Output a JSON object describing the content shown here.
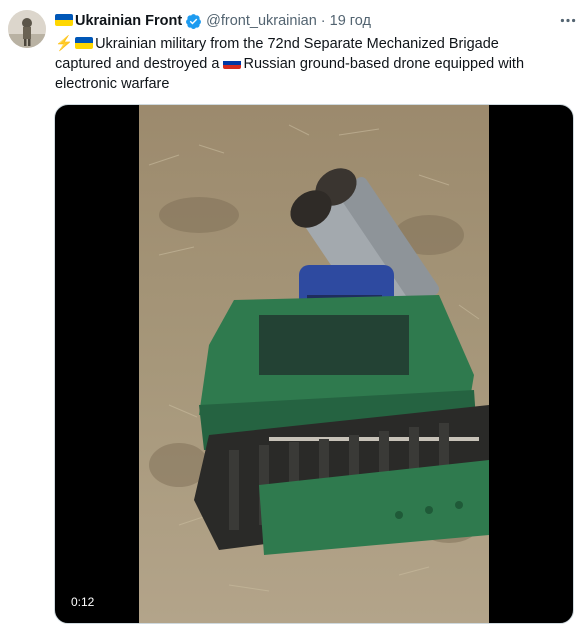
{
  "account": {
    "display_name": "Ukrainian Front",
    "handle": "@front_ukrainian",
    "separator": "·",
    "timestamp": "19 год"
  },
  "tweet": {
    "text_1": "Ukrainian military from the 72nd Separate Mechanized Brigade captured and destroyed a ",
    "text_2": "Russian ground-based drone equipped with electronic warfare"
  },
  "media": {
    "duration": "0:12"
  },
  "colors": {
    "ukraine_blue": "#0057b7",
    "ukraine_yellow": "#ffd700",
    "verified_blue": "#1d9bf0",
    "muted_text": "#536471"
  },
  "icons": {
    "verified": "verified-badge-icon",
    "more": "more-options-icon",
    "bolt": "lightning-icon"
  }
}
